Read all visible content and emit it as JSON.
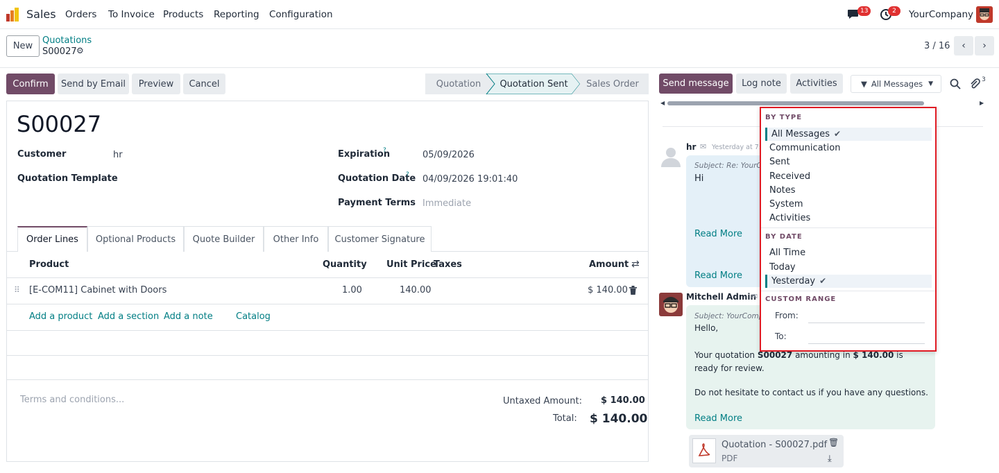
{
  "nav": {
    "app_name": "Sales",
    "menu": [
      "Orders",
      "To Invoice",
      "Products",
      "Reporting",
      "Configuration"
    ],
    "messages_count": "13",
    "activities_count": "2",
    "company": "YourCompany"
  },
  "control": {
    "new_label": "New",
    "breadcrumb_parent": "Quotations",
    "breadcrumb_current": "S00027",
    "pager": "3 / 16"
  },
  "actions": {
    "confirm": "Confirm",
    "send_email": "Send by Email",
    "preview": "Preview",
    "cancel": "Cancel"
  },
  "stages": [
    "Quotation",
    "Quotation Sent",
    "Sales Order"
  ],
  "active_stage": "Quotation Sent",
  "form": {
    "name": "S00027",
    "customer_label": "Customer",
    "customer_value": "hr",
    "template_label": "Quotation Template",
    "expiration_label": "Expiration",
    "expiration_value": "05/09/2026",
    "qdate_label": "Quotation Date",
    "qdate_value": "04/09/2026 19:01:40",
    "terms_label": "Payment Terms",
    "terms_placeholder": "Immediate",
    "help_mark": "?"
  },
  "tabs": [
    "Order Lines",
    "Optional Products",
    "Quote Builder",
    "Other Info",
    "Customer Signature"
  ],
  "table": {
    "headers": {
      "product": "Product",
      "quantity": "Quantity",
      "unit_price": "Unit Price",
      "taxes": "Taxes",
      "amount": "Amount"
    },
    "rows": [
      {
        "product": "[E-COM11] Cabinet with Doors",
        "quantity": "1.00",
        "unit_price": "140.00",
        "taxes": "",
        "amount": "$ 140.00"
      }
    ],
    "add_links": [
      "Add a product",
      "Add a section",
      "Add a note",
      "Catalog"
    ]
  },
  "footer": {
    "terms_placeholder": "Terms and conditions...",
    "untaxed_label": "Untaxed Amount:",
    "untaxed_value": "$ 140.00",
    "total_label": "Total:",
    "total_value": "$ 140.00"
  },
  "chatter": {
    "send_message": "Send message",
    "log_note": "Log note",
    "activities": "Activities",
    "filter_label": "All Messages",
    "attachments_count": "3",
    "messages": [
      {
        "author": "hr",
        "time": "Yesterday at 7:...",
        "subject": "Subject: Re: YourCo...",
        "body": "Hi",
        "read_more_1": "Read More",
        "read_more_2": "Read More"
      },
      {
        "author": "Mitchell Admin",
        "subject": "Subject: YourComp...",
        "greeting": "Hello,",
        "body_pre": "Your quotation ",
        "body_bold1": "S00027",
        "body_mid": " amounting in ",
        "body_bold2": "$ 140.00",
        "body_post": " is ready for review.",
        "body_2": "Do not hesitate to contact us if you have any questions.",
        "read_more": "Read More"
      }
    ],
    "attachment": {
      "name": "Quotation - S00027.pdf",
      "type": "PDF"
    }
  },
  "dropdown": {
    "by_type_header": "BY TYPE",
    "by_type": [
      "All Messages",
      "Communication",
      "Sent",
      "Received",
      "Notes",
      "System",
      "Activities"
    ],
    "by_type_selected": "All Messages",
    "by_date_header": "BY DATE",
    "by_date": [
      "All Time",
      "Today",
      "Yesterday"
    ],
    "by_date_selected": "Yesterday",
    "custom_header": "CUSTOM RANGE",
    "from_label": "From:",
    "to_label": "To:"
  },
  "colors": {
    "brand": "#714b67",
    "link": "#017e84",
    "highlight": "#e01b24",
    "note_bg": "#e7f3ef",
    "message_bg": "#e4f0f8"
  }
}
